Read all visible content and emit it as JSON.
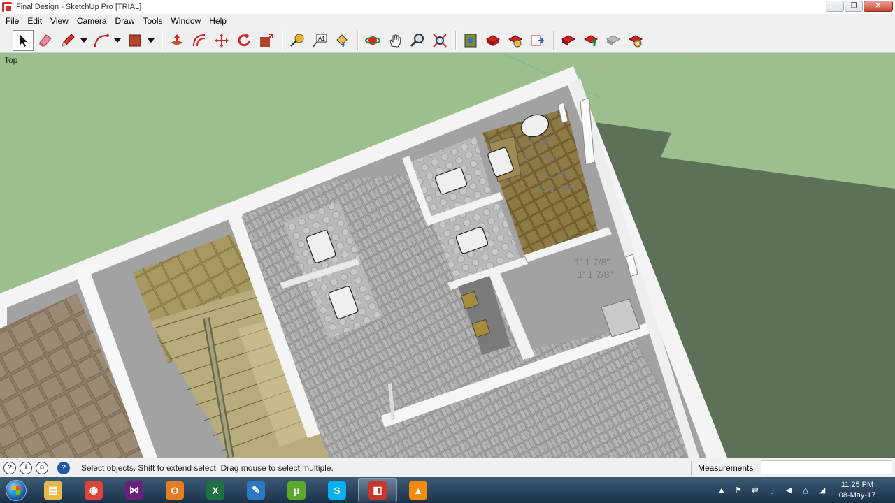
{
  "window": {
    "title": "Final Design - SketchUp Pro [TRIAL]",
    "minimize": "–",
    "restore": "❐",
    "close": "✕"
  },
  "menu": [
    "File",
    "Edit",
    "View",
    "Camera",
    "Draw",
    "Tools",
    "Window",
    "Help"
  ],
  "toolbar": {
    "tools": [
      {
        "name": "select-tool",
        "icon": "arrow-icon",
        "active": true
      },
      {
        "name": "eraser-tool",
        "icon": "eraser-icon"
      },
      {
        "name": "line-tool",
        "icon": "pencil-icon",
        "dropdown": true
      },
      {
        "name": "arc-tool",
        "icon": "arc-icon",
        "dropdown": true
      },
      {
        "name": "rectangle-tool",
        "icon": "rectangle-icon",
        "dropdown": true
      },
      {
        "name": "push-pull-tool",
        "icon": "push-pull-icon"
      },
      {
        "name": "offset-tool",
        "icon": "offset-icon"
      },
      {
        "name": "move-tool",
        "icon": "move-icon"
      },
      {
        "name": "rotate-tool",
        "icon": "rotate-icon"
      },
      {
        "name": "scale-tool",
        "icon": "scale-icon"
      },
      {
        "name": "tape-measure-tool",
        "icon": "tape-measure-icon"
      },
      {
        "name": "text-tool",
        "icon": "text-icon"
      },
      {
        "name": "paint-bucket-tool",
        "icon": "paint-bucket-icon"
      },
      {
        "name": "orbit-tool",
        "icon": "orbit-icon"
      },
      {
        "name": "pan-tool",
        "icon": "hand-icon"
      },
      {
        "name": "zoom-tool",
        "icon": "zoom-icon"
      },
      {
        "name": "zoom-extents-tool",
        "icon": "zoom-extents-icon"
      },
      {
        "name": "3d-warehouse-tool",
        "icon": "warehouse-icon"
      },
      {
        "name": "extension-warehouse-tool",
        "icon": "extension-icon"
      },
      {
        "name": "layout-tool",
        "icon": "layout-icon"
      },
      {
        "name": "send-to-layout-tool",
        "icon": "send-icon"
      },
      {
        "name": "extension-1-tool",
        "icon": "extension-red-icon"
      },
      {
        "name": "extension-2-tool",
        "icon": "extension-green-icon"
      },
      {
        "name": "extension-3-tool",
        "icon": "extension-gray-icon"
      },
      {
        "name": "extension-4-tool",
        "icon": "extension-gear-icon"
      }
    ],
    "text_tool_label": "A1"
  },
  "viewport": {
    "view_label": "Top",
    "dimensions": [
      "1' 1 7/8\"",
      "1' 1 7/8\"",
      "1' 1 7/8\"",
      "1' 1 7/8\"",
      "1' 1 7/8\"",
      "1' 1 7/8\""
    ]
  },
  "status": {
    "message": "Select objects. Shift to extend select. Drag mouse to select multiple.",
    "measurements_label": "Measurements",
    "measurements_value": ""
  },
  "taskbar": {
    "apps": [
      {
        "name": "explorer",
        "icon": "folder-icon",
        "color": "#e8b84a",
        "glyph": "▤"
      },
      {
        "name": "chrome",
        "icon": "chrome-icon",
        "color": "#db4437",
        "glyph": "◉"
      },
      {
        "name": "visual-studio",
        "icon": "visual-studio-icon",
        "color": "#68217a",
        "glyph": "⋈"
      },
      {
        "name": "outlook",
        "icon": "outlook-icon",
        "color": "#e67e22",
        "glyph": "O"
      },
      {
        "name": "excel",
        "icon": "excel-icon",
        "color": "#1d7044",
        "glyph": "X"
      },
      {
        "name": "notes",
        "icon": "notes-icon",
        "color": "#2b79c2",
        "glyph": "✎"
      },
      {
        "name": "utorrent",
        "icon": "utorrent-icon",
        "color": "#5ca82e",
        "glyph": "μ"
      },
      {
        "name": "skype",
        "icon": "skype-icon",
        "color": "#00aff0",
        "glyph": "S"
      },
      {
        "name": "sketchup",
        "icon": "sketchup-icon",
        "color": "#c8372d",
        "glyph": "◧",
        "open": true
      },
      {
        "name": "vlc",
        "icon": "vlc-icon",
        "color": "#f28c0f",
        "glyph": "▲"
      }
    ],
    "clock_time": "11:25 PM",
    "clock_date": "08-May-17"
  }
}
